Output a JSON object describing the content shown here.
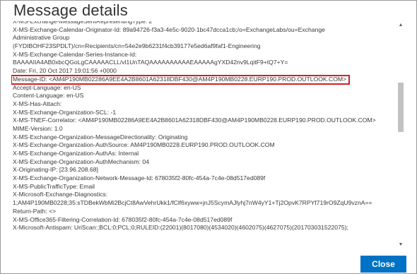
{
  "dialog": {
    "title": "Message details",
    "close_label": "Close"
  },
  "headers": [
    "X-MS-Exchange-MessageSentRepresentingType: 2",
    "X-MS-Exchange-Calendar-Originator-Id: 89a94726-f3a3-4e5c-9020-1bc47dcca1cb;/o=ExchangeLabs/ou=Exchange",
    " Administrative Group",
    " (FYDIBOHF23SPDLT)/cn=Recipients/cn=54e2e9b6231f4cb39177e5ed6af9faf1-Engineering",
    "X-MS-Exchange-Calendar-Series-Instance-Id:",
    "BAAAAIIA4AB0xbcQGoLgCAAAAACLL/vl1UnTAQAAAAAAAAAAEAAAAAgYXD42nv9LqitF9+tQ7+Y=",
    "Date: Fri, 20 Oct 2017 19:01:56 +0000",
    "Message-ID: <AM4P190MB02286A9EE4A2B8601A62318DBF430@AM4P190MB0228.EURP190.PROD.OUTLOOK.COM>",
    "Accept-Language: en-US",
    "Content-Language: en-US",
    "X-MS-Has-Attach:",
    "X-MS-Exchange-Organization-SCL: -1",
    "X-MS-TNEF-Correlator: <AM4P190MB02286A9EE4A2B8601A62318DBF430@AM4P190MB0228.EURP190.PROD.OUTLOOK.COM>",
    "MIME-Version: 1.0",
    "X-MS-Exchange-Organization-MessageDirectionality: Originating",
    "X-MS-Exchange-Organization-AuthSource: AM4P190MB0228.EURP190.PROD.OUTLOOK.COM",
    "X-MS-Exchange-Organization-AuthAs: Internal",
    "X-MS-Exchange-Organization-AuthMechanism: 04",
    "X-Originating-IP: [23.96.208.68]",
    "X-MS-Exchange-Organization-Network-Message-Id: 678035f2-80fc-454a-7c4e-08d517ed089f",
    "X-MS-PublicTrafficType: Email",
    "X-Microsoft-Exchange-Diagnostics:",
    "1;AM4P190MB0228;35:sTDBekWbMi2BcjCt8AwVehrUkk1/fClf6xyww+jnJ5ScymAJlyhj7nW4yY1+Tj2OpvK7RPYf719rO9ZqU9vznA==",
    "Return-Path: <>",
    "X-MS-Office365-Filtering-Correlation-Id: 678035f2-80fc-454a-7c4e-08d517ed089f",
    "X-Microsoft-Antispam: UriScan:;BCL:0;PCL:0;RULEID:(22001)(8017080)(4534020)(4602075)(4627075)(201703031522075);"
  ],
  "highlighted_index": 7,
  "scroll": {
    "position_fraction": 0.35
  }
}
